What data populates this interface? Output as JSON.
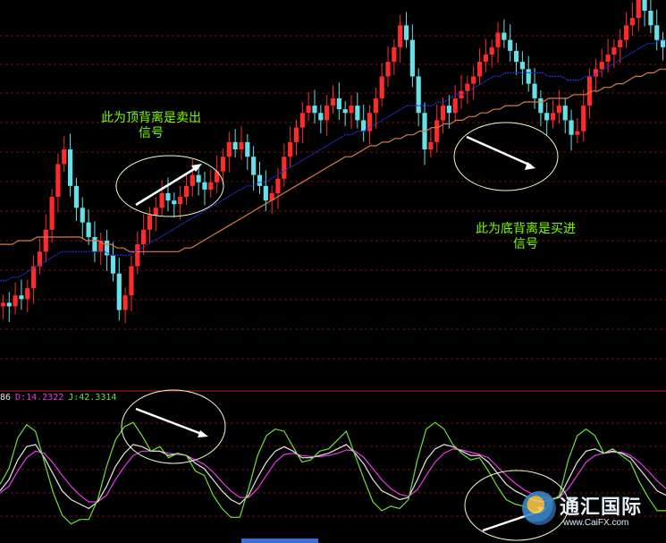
{
  "colors": {
    "up": "#ff2a2a",
    "down": "#66e0e6",
    "ma_fast": "#2330d8",
    "ma_slow": "#d8784a",
    "grid": "#6b1010",
    "divider": "#c02020",
    "k": "#e6e6e6",
    "d": "#e838e8",
    "j": "#6ee03a",
    "annotation": "#7CFC00",
    "arrow": "#ffffff"
  },
  "annotations": {
    "top_divergence": "此为顶背离是卖出信号",
    "bottom_divergence": "此为底背离是买进信号"
  },
  "kdj_header": {
    "k_tail": "86",
    "d_label": "D:14.2322",
    "j_label": "J:42.3314"
  },
  "watermark": {
    "name": "通汇国际",
    "url": "www.CaiFX.com"
  },
  "chart_data": [
    {
      "type": "candlestick",
      "title": "",
      "pattern": "top and bottom divergence",
      "y_range": [
        0,
        100
      ],
      "closes": [
        20,
        19,
        22,
        21,
        24,
        30,
        34,
        40,
        49,
        58,
        62,
        52,
        46,
        42,
        38,
        34,
        37,
        33,
        28,
        18,
        22,
        30,
        36,
        40,
        44,
        46,
        50,
        48,
        47,
        49,
        52,
        55,
        53,
        51,
        53,
        56,
        60,
        64,
        62,
        64,
        60,
        55,
        52,
        48,
        50,
        54,
        60,
        64,
        68,
        72,
        74,
        72,
        70,
        74,
        76,
        73,
        72,
        74,
        70,
        67,
        72,
        76,
        82,
        86,
        90,
        96,
        92,
        82,
        72,
        62,
        64,
        70,
        74,
        72,
        76,
        78,
        80,
        82,
        86,
        88,
        90,
        94,
        92,
        89,
        86,
        84,
        80,
        76,
        72,
        70,
        72,
        74,
        70,
        66,
        67,
        74,
        82,
        84,
        86,
        88,
        90,
        92,
        96,
        98,
        104,
        100,
        96,
        92,
        90
      ],
      "ma_fast": [
        26,
        26,
        27,
        27,
        28,
        29,
        30,
        31,
        32,
        33,
        34,
        34,
        34,
        34,
        34,
        34,
        34,
        34,
        33,
        33,
        33,
        33,
        34,
        35,
        36,
        37,
        38,
        39,
        40,
        41,
        42,
        43,
        44,
        45,
        46,
        47,
        48,
        49,
        50,
        51,
        52,
        52,
        53,
        53,
        54,
        55,
        56,
        57,
        58,
        59,
        60,
        61,
        62,
        63,
        64,
        65,
        66,
        66,
        67,
        67,
        68,
        69,
        70,
        71,
        72,
        73,
        74,
        74,
        74,
        74,
        74,
        75,
        75,
        76,
        77,
        77,
        78,
        79,
        80,
        81,
        82,
        82,
        83,
        83,
        83,
        83,
        83,
        83,
        83,
        82,
        82,
        82,
        81,
        81,
        81,
        82,
        82,
        83,
        84,
        85,
        86,
        87,
        88,
        89,
        90,
        91,
        91,
        92,
        92
      ],
      "ma_slow": [
        36,
        36,
        36,
        37,
        37,
        37,
        38,
        38,
        38,
        38,
        38,
        38,
        38,
        38,
        37,
        37,
        37,
        36,
        36,
        35,
        35,
        34,
        34,
        34,
        34,
        34,
        34,
        34,
        34,
        34,
        35,
        35,
        36,
        37,
        38,
        39,
        40,
        41,
        42,
        43,
        44,
        45,
        46,
        47,
        48,
        49,
        50,
        51,
        52,
        53,
        54,
        55,
        56,
        57,
        58,
        59,
        60,
        60,
        61,
        62,
        63,
        63,
        64,
        64,
        65,
        65,
        66,
        66,
        67,
        67,
        68,
        68,
        69,
        69,
        70,
        70,
        71,
        71,
        72,
        72,
        73,
        73,
        74,
        74,
        74,
        75,
        75,
        75,
        75,
        76,
        76,
        76,
        76,
        77,
        77,
        77,
        78,
        78,
        79,
        79,
        80,
        80,
        81,
        82,
        82,
        83,
        83,
        84,
        84
      ]
    },
    {
      "type": "line",
      "title": "KDJ",
      "y_range": [
        -10,
        110
      ],
      "series": [
        {
          "name": "K",
          "values": [
            30,
            40,
            58,
            70,
            72,
            60,
            45,
            30,
            22,
            18,
            14,
            20,
            34,
            52,
            64,
            72,
            70,
            66,
            66,
            62,
            64,
            62,
            55,
            50,
            40,
            30,
            22,
            18,
            26,
            42,
            56,
            66,
            70,
            66,
            60,
            60,
            62,
            64,
            68,
            72,
            64,
            54,
            40,
            30,
            26,
            22,
            24,
            40,
            58,
            68,
            72,
            70,
            66,
            62,
            62,
            56,
            46,
            36,
            30,
            26,
            22,
            20,
            22,
            24,
            40,
            56,
            66,
            68,
            64,
            66,
            64,
            60,
            50,
            40,
            30,
            26
          ]
        },
        {
          "name": "D",
          "values": [
            28,
            34,
            48,
            60,
            66,
            64,
            55,
            44,
            34,
            26,
            20,
            20,
            26,
            40,
            52,
            62,
            66,
            66,
            66,
            64,
            63,
            62,
            58,
            54,
            47,
            38,
            30,
            24,
            24,
            32,
            44,
            56,
            63,
            64,
            62,
            61,
            61,
            62,
            64,
            67,
            66,
            60,
            50,
            40,
            32,
            27,
            25,
            31,
            44,
            56,
            64,
            68,
            67,
            65,
            63,
            60,
            52,
            44,
            37,
            31,
            27,
            24,
            23,
            24,
            32,
            44,
            56,
            62,
            64,
            65,
            65,
            62,
            56,
            48,
            39,
            32
          ]
        },
        {
          "name": "J",
          "values": [
            36,
            50,
            78,
            90,
            84,
            56,
            28,
            8,
            0,
            4,
            4,
            22,
            52,
            76,
            88,
            92,
            80,
            66,
            70,
            60,
            64,
            62,
            48,
            44,
            26,
            14,
            6,
            6,
            32,
            62,
            80,
            86,
            84,
            70,
            56,
            58,
            66,
            68,
            76,
            84,
            62,
            40,
            20,
            12,
            16,
            14,
            22,
            58,
            86,
            92,
            86,
            72,
            64,
            58,
            60,
            48,
            34,
            22,
            18,
            16,
            12,
            10,
            20,
            26,
            58,
            80,
            86,
            80,
            64,
            68,
            62,
            56,
            38,
            24,
            12,
            12
          ]
        }
      ]
    }
  ]
}
